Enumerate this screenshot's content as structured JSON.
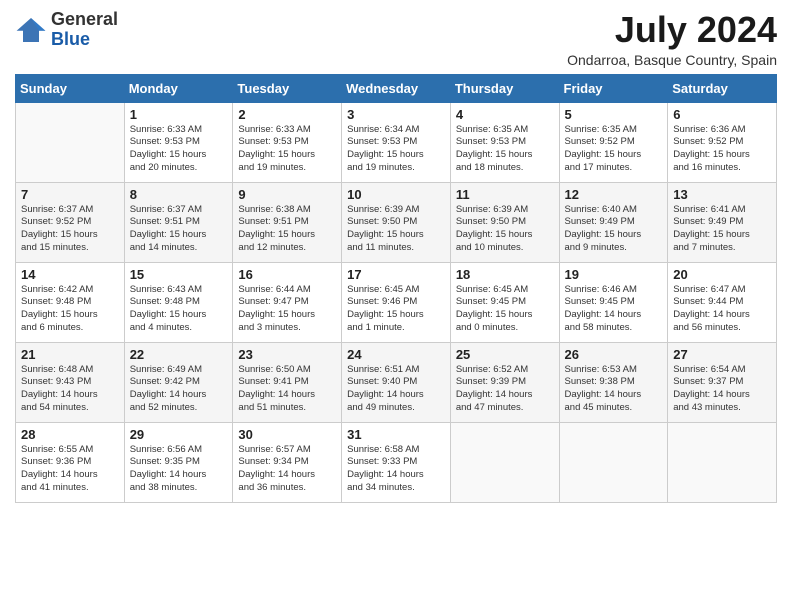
{
  "header": {
    "logo_general": "General",
    "logo_blue": "Blue",
    "month_title": "July 2024",
    "subtitle": "Ondarroa, Basque Country, Spain"
  },
  "days_of_week": [
    "Sunday",
    "Monday",
    "Tuesday",
    "Wednesday",
    "Thursday",
    "Friday",
    "Saturday"
  ],
  "weeks": [
    [
      {
        "day": "",
        "info": ""
      },
      {
        "day": "1",
        "info": "Sunrise: 6:33 AM\nSunset: 9:53 PM\nDaylight: 15 hours\nand 20 minutes."
      },
      {
        "day": "2",
        "info": "Sunrise: 6:33 AM\nSunset: 9:53 PM\nDaylight: 15 hours\nand 19 minutes."
      },
      {
        "day": "3",
        "info": "Sunrise: 6:34 AM\nSunset: 9:53 PM\nDaylight: 15 hours\nand 19 minutes."
      },
      {
        "day": "4",
        "info": "Sunrise: 6:35 AM\nSunset: 9:53 PM\nDaylight: 15 hours\nand 18 minutes."
      },
      {
        "day": "5",
        "info": "Sunrise: 6:35 AM\nSunset: 9:52 PM\nDaylight: 15 hours\nand 17 minutes."
      },
      {
        "day": "6",
        "info": "Sunrise: 6:36 AM\nSunset: 9:52 PM\nDaylight: 15 hours\nand 16 minutes."
      }
    ],
    [
      {
        "day": "7",
        "info": "Sunrise: 6:37 AM\nSunset: 9:52 PM\nDaylight: 15 hours\nand 15 minutes."
      },
      {
        "day": "8",
        "info": "Sunrise: 6:37 AM\nSunset: 9:51 PM\nDaylight: 15 hours\nand 14 minutes."
      },
      {
        "day": "9",
        "info": "Sunrise: 6:38 AM\nSunset: 9:51 PM\nDaylight: 15 hours\nand 12 minutes."
      },
      {
        "day": "10",
        "info": "Sunrise: 6:39 AM\nSunset: 9:50 PM\nDaylight: 15 hours\nand 11 minutes."
      },
      {
        "day": "11",
        "info": "Sunrise: 6:39 AM\nSunset: 9:50 PM\nDaylight: 15 hours\nand 10 minutes."
      },
      {
        "day": "12",
        "info": "Sunrise: 6:40 AM\nSunset: 9:49 PM\nDaylight: 15 hours\nand 9 minutes."
      },
      {
        "day": "13",
        "info": "Sunrise: 6:41 AM\nSunset: 9:49 PM\nDaylight: 15 hours\nand 7 minutes."
      }
    ],
    [
      {
        "day": "14",
        "info": "Sunrise: 6:42 AM\nSunset: 9:48 PM\nDaylight: 15 hours\nand 6 minutes."
      },
      {
        "day": "15",
        "info": "Sunrise: 6:43 AM\nSunset: 9:48 PM\nDaylight: 15 hours\nand 4 minutes."
      },
      {
        "day": "16",
        "info": "Sunrise: 6:44 AM\nSunset: 9:47 PM\nDaylight: 15 hours\nand 3 minutes."
      },
      {
        "day": "17",
        "info": "Sunrise: 6:45 AM\nSunset: 9:46 PM\nDaylight: 15 hours\nand 1 minute."
      },
      {
        "day": "18",
        "info": "Sunrise: 6:45 AM\nSunset: 9:45 PM\nDaylight: 15 hours\nand 0 minutes."
      },
      {
        "day": "19",
        "info": "Sunrise: 6:46 AM\nSunset: 9:45 PM\nDaylight: 14 hours\nand 58 minutes."
      },
      {
        "day": "20",
        "info": "Sunrise: 6:47 AM\nSunset: 9:44 PM\nDaylight: 14 hours\nand 56 minutes."
      }
    ],
    [
      {
        "day": "21",
        "info": "Sunrise: 6:48 AM\nSunset: 9:43 PM\nDaylight: 14 hours\nand 54 minutes."
      },
      {
        "day": "22",
        "info": "Sunrise: 6:49 AM\nSunset: 9:42 PM\nDaylight: 14 hours\nand 52 minutes."
      },
      {
        "day": "23",
        "info": "Sunrise: 6:50 AM\nSunset: 9:41 PM\nDaylight: 14 hours\nand 51 minutes."
      },
      {
        "day": "24",
        "info": "Sunrise: 6:51 AM\nSunset: 9:40 PM\nDaylight: 14 hours\nand 49 minutes."
      },
      {
        "day": "25",
        "info": "Sunrise: 6:52 AM\nSunset: 9:39 PM\nDaylight: 14 hours\nand 47 minutes."
      },
      {
        "day": "26",
        "info": "Sunrise: 6:53 AM\nSunset: 9:38 PM\nDaylight: 14 hours\nand 45 minutes."
      },
      {
        "day": "27",
        "info": "Sunrise: 6:54 AM\nSunset: 9:37 PM\nDaylight: 14 hours\nand 43 minutes."
      }
    ],
    [
      {
        "day": "28",
        "info": "Sunrise: 6:55 AM\nSunset: 9:36 PM\nDaylight: 14 hours\nand 41 minutes."
      },
      {
        "day": "29",
        "info": "Sunrise: 6:56 AM\nSunset: 9:35 PM\nDaylight: 14 hours\nand 38 minutes."
      },
      {
        "day": "30",
        "info": "Sunrise: 6:57 AM\nSunset: 9:34 PM\nDaylight: 14 hours\nand 36 minutes."
      },
      {
        "day": "31",
        "info": "Sunrise: 6:58 AM\nSunset: 9:33 PM\nDaylight: 14 hours\nand 34 minutes."
      },
      {
        "day": "",
        "info": ""
      },
      {
        "day": "",
        "info": ""
      },
      {
        "day": "",
        "info": ""
      }
    ]
  ]
}
